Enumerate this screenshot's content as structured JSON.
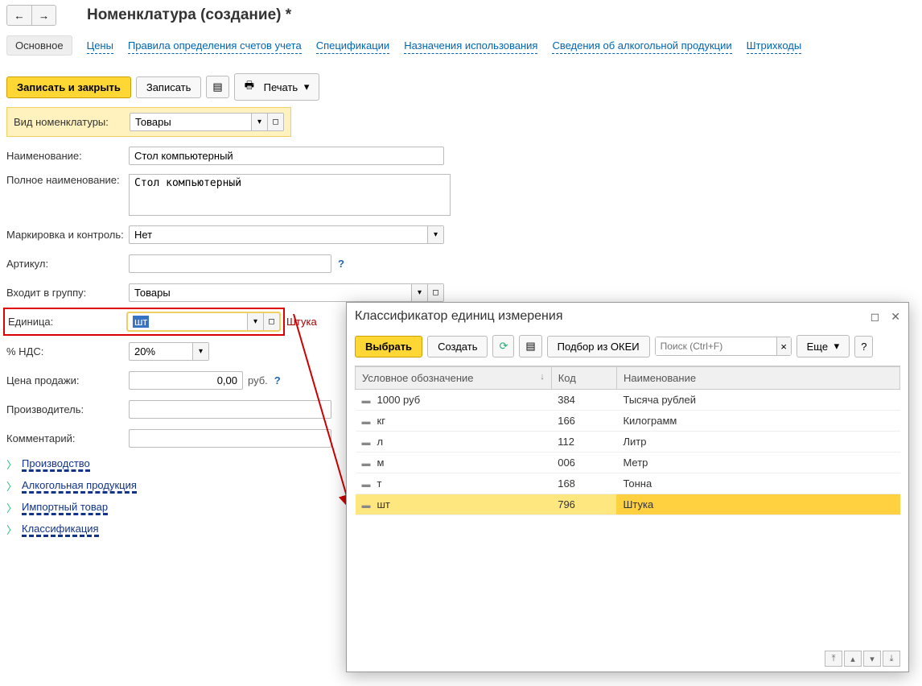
{
  "header": {
    "title": "Номенклатура (создание) *"
  },
  "tabs": [
    "Основное",
    "Цены",
    "Правила определения счетов учета",
    "Спецификации",
    "Назначения использования",
    "Сведения об алкогольной продукции",
    "Штрихкоды"
  ],
  "toolbar": {
    "save_close": "Записать и закрыть",
    "save": "Записать",
    "print": "Печать"
  },
  "form": {
    "type_label": "Вид номенклатуры:",
    "type_value": "Товары",
    "name_label": "Наименование:",
    "name_value": "Стол компьютерный",
    "fullname_label": "Полное наименование:",
    "fullname_value": "Стол компьютерный",
    "marking_label": "Маркировка и контроль:",
    "marking_value": "Нет",
    "article_label": "Артикул:",
    "article_value": "",
    "group_label": "Входит в группу:",
    "group_value": "Товары",
    "unit_label": "Единица:",
    "unit_value": "шт",
    "unit_suffix": "Штука",
    "vat_label": "% НДС:",
    "vat_value": "20%",
    "price_label": "Цена продажи:",
    "price_value": "0,00",
    "price_suffix": "руб.",
    "manufacturer_label": "Производитель:",
    "manufacturer_value": "",
    "comment_label": "Комментарий:",
    "comment_value": ""
  },
  "collapse": [
    "Производство",
    "Алкогольная продукция",
    "Импортный товар",
    "Классификация"
  ],
  "popup": {
    "title": "Классификатор единиц измерения",
    "select": "Выбрать",
    "create": "Создать",
    "okei": "Подбор из ОКЕИ",
    "search_placeholder": "Поиск (Ctrl+F)",
    "more": "Еще",
    "cols": {
      "sym": "Условное обозначение",
      "code": "Код",
      "name": "Наименование"
    },
    "rows": [
      {
        "sym": "1000 руб",
        "code": "384",
        "name": "Тысяча рублей"
      },
      {
        "sym": "кг",
        "code": "166",
        "name": "Килограмм"
      },
      {
        "sym": "л",
        "code": "112",
        "name": "Литр"
      },
      {
        "sym": "м",
        "code": "006",
        "name": "Метр"
      },
      {
        "sym": "т",
        "code": "168",
        "name": "Тонна"
      },
      {
        "sym": "шт",
        "code": "796",
        "name": "Штука"
      }
    ]
  }
}
